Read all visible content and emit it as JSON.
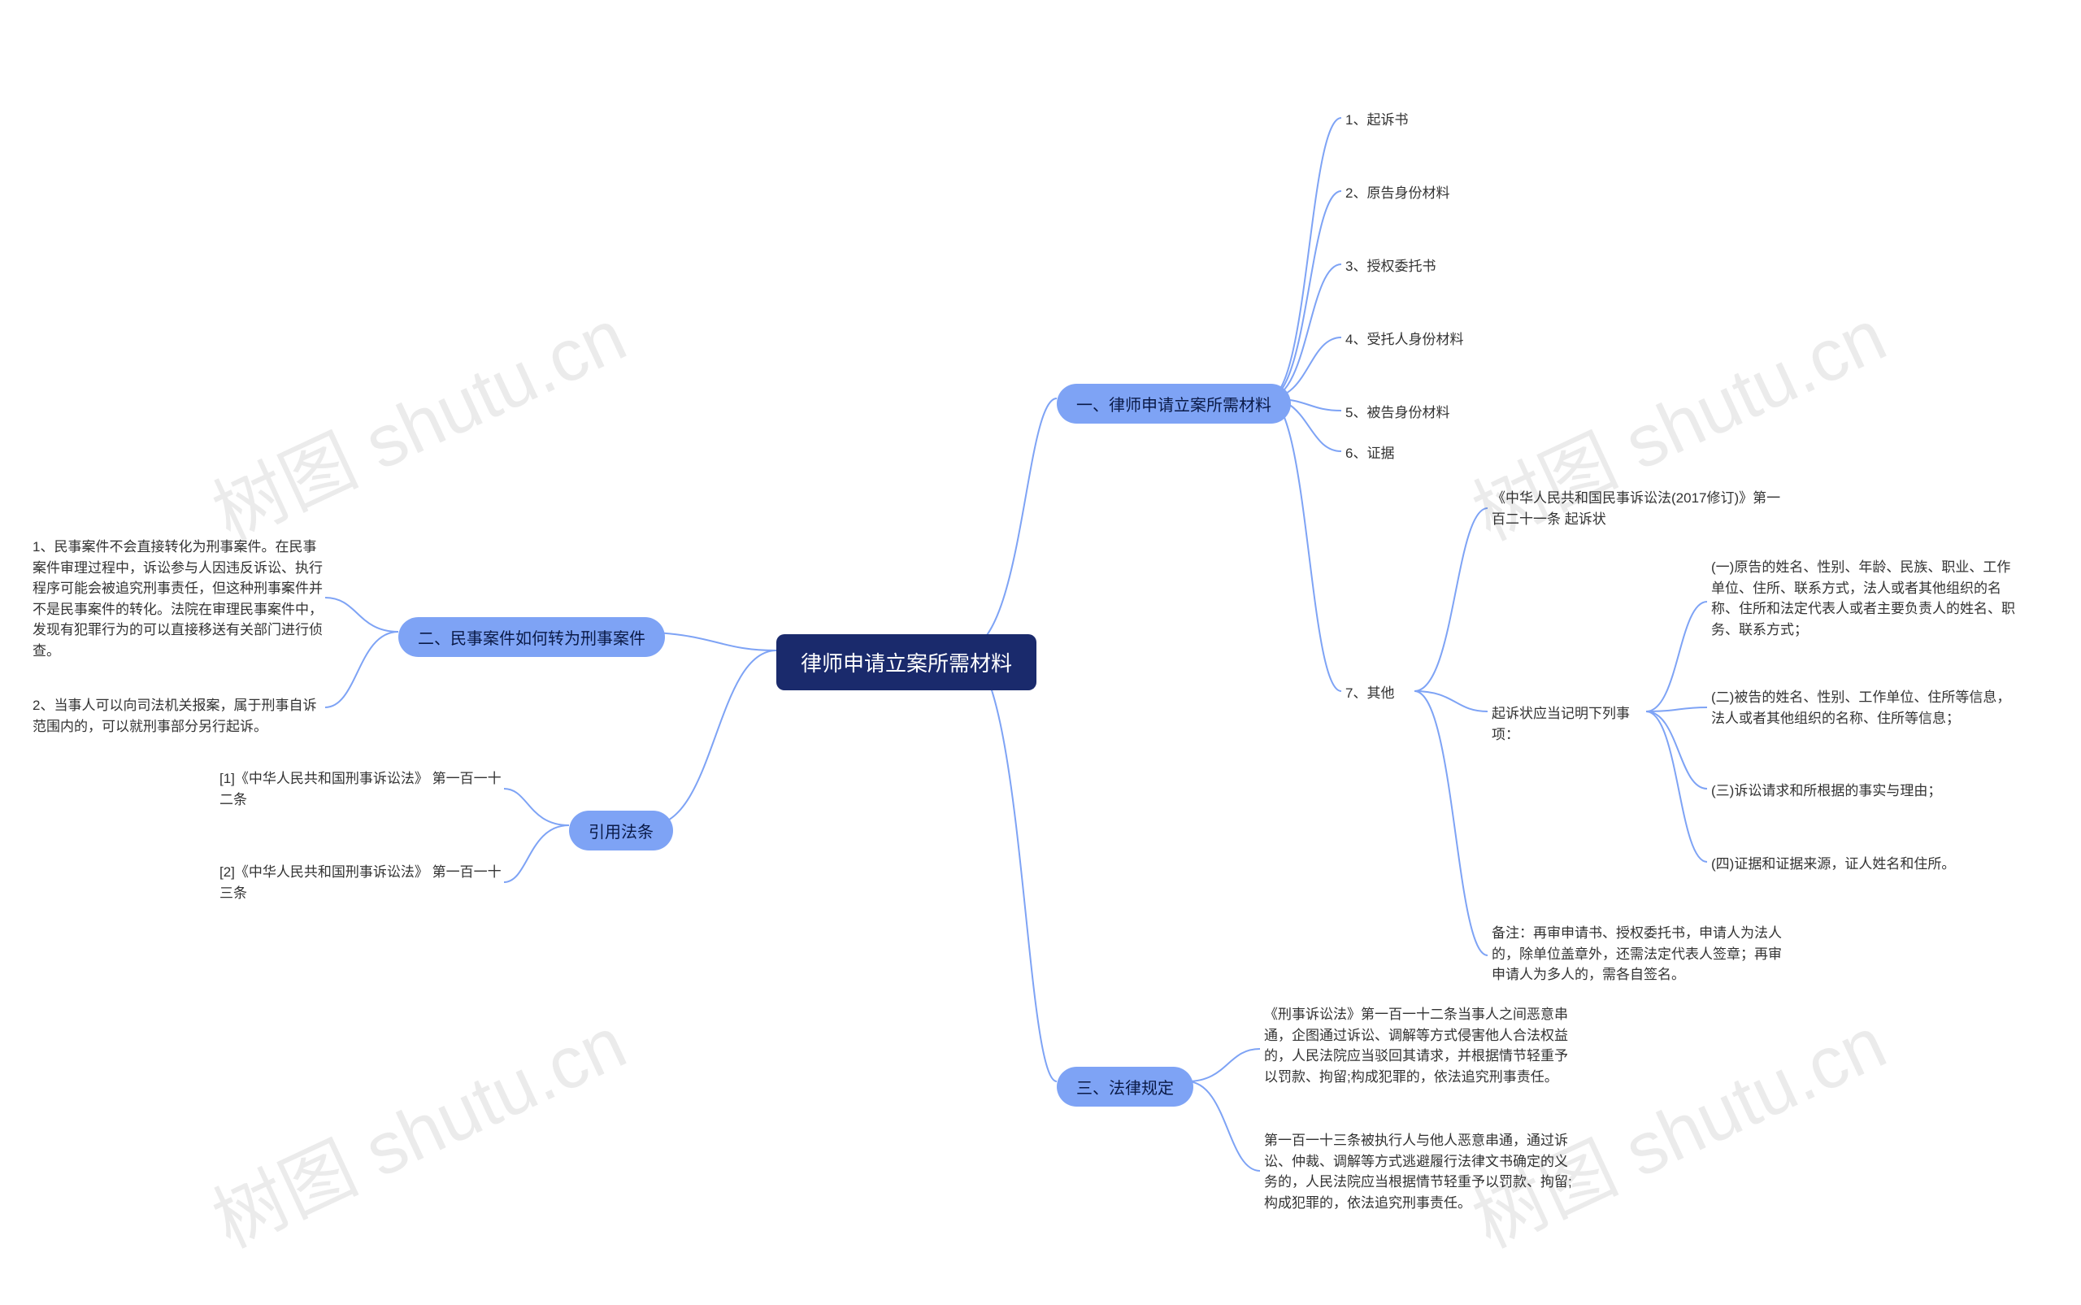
{
  "center": "律师申请立案所需材料",
  "watermark": "树图 shutu.cn",
  "right": {
    "section1": {
      "title": "一、律师申请立案所需材料",
      "items": [
        "1、起诉书",
        "2、原告身份材料",
        "3、授权委托书",
        "4、受托人身份材料",
        "5、被告身份材料",
        "6、证据"
      ],
      "other": {
        "label": "7、其他",
        "law": "《中华人民共和国民事诉讼法(2017修订)》第一百二十一条 起诉状",
        "sub_header": "起诉状应当记明下列事项：",
        "subs": [
          "(一)原告的姓名、性别、年龄、民族、职业、工作单位、住所、联系方式，法人或者其他组织的名称、住所和法定代表人或者主要负责人的姓名、职务、联系方式；",
          "(二)被告的姓名、性别、工作单位、住所等信息，法人或者其他组织的名称、住所等信息；",
          "(三)诉讼请求和所根据的事实与理由；",
          "(四)证据和证据来源，证人姓名和住所。"
        ],
        "note": "备注：再审申请书、授权委托书，申请人为法人的，除单位盖章外，还需法定代表人签章；再审申请人为多人的，需各自签名。"
      }
    },
    "section3": {
      "title": "三、法律规定",
      "items": [
        "《刑事诉讼法》第一百一十二条当事人之间恶意串通，企图通过诉讼、调解等方式侵害他人合法权益的，人民法院应当驳回其请求，并根据情节轻重予以罚款、拘留;构成犯罪的，依法追究刑事责任。",
        "第一百一十三条被执行人与他人恶意串通，通过诉讼、仲裁、调解等方式逃避履行法律文书确定的义务的，人民法院应当根据情节轻重予以罚款、拘留;构成犯罪的，依法追究刑事责任。"
      ]
    }
  },
  "left": {
    "section2": {
      "title": "二、民事案件如何转为刑事案件",
      "items": [
        "1、民事案件不会直接转化为刑事案件。在民事案件审理过程中，诉讼参与人因违反诉讼、执行程序可能会被追究刑事责任，但这种刑事案件并不是民事案件的转化。法院在审理民事案件中，发现有犯罪行为的可以直接移送有关部门进行侦查。",
        "2、当事人可以向司法机关报案，属于刑事自诉范围内的，可以就刑事部分另行起诉。"
      ]
    },
    "cites": {
      "title": "引用法条",
      "items": [
        "[1]《中华人民共和国刑事诉讼法》 第一百一十二条",
        "[2]《中华人民共和国刑事诉讼法》 第一百一十三条"
      ]
    }
  }
}
